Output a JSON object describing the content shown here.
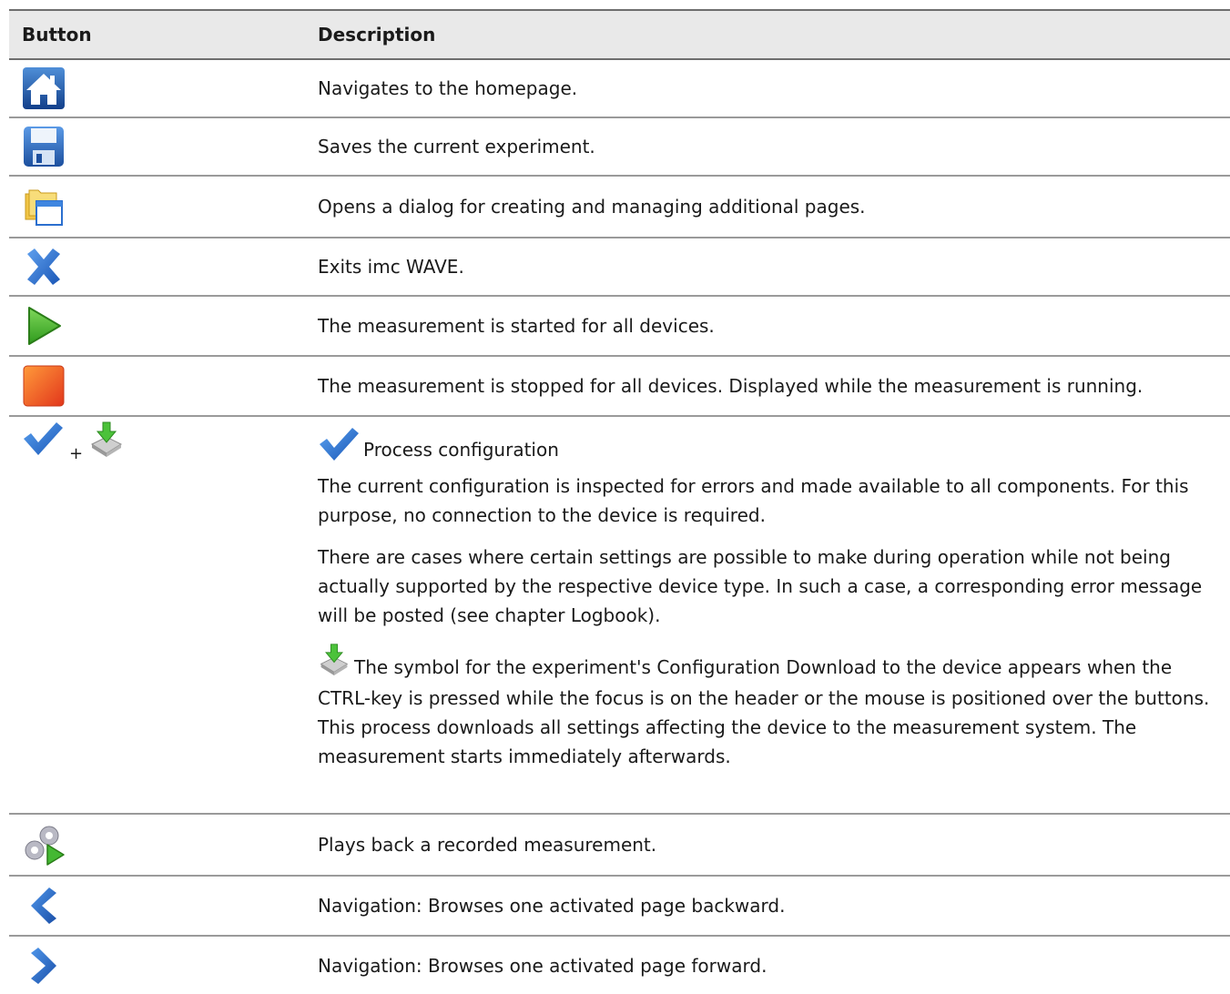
{
  "header": {
    "col_button": "Button",
    "col_description": "Description"
  },
  "rows": [
    {
      "icon": "home-icon",
      "description": "Navigates to the homepage."
    },
    {
      "icon": "save-icon",
      "description": "Saves the current experiment."
    },
    {
      "icon": "pages-icon",
      "description": "Opens a dialog for creating and managing additional pages."
    },
    {
      "icon": "close-icon",
      "description": "Exits imc WAVE."
    },
    {
      "icon": "play-icon",
      "description": "The measurement is started for all devices."
    },
    {
      "icon": "stop-icon",
      "description": "The measurement is stopped for all devices. Displayed while the measurement is running."
    }
  ],
  "process": {
    "icons": [
      "checkmark-icon",
      "download-icon"
    ],
    "plus": "+",
    "title": "Process configuration",
    "para1": "The current configuration is inspected for errors and made available to all components. For this purpose, no connection to the device is required.",
    "para2": "There are cases where certain settings are possible to make during operation while not being actually supported by the respective device type. In such a case, a corresponding error message will be posted (see chapter Logbook).",
    "para3": "The symbol for the experiment's Configuration Download  to the device appears when the CTRL-key is pressed while the focus is on the header or the mouse is positioned over the buttons. This process downloads all settings affecting the device to the measurement system. The measurement starts immediately afterwards."
  },
  "rows2": [
    {
      "icon": "playback-gears-icon",
      "description": "Plays back a recorded measurement."
    },
    {
      "icon": "chevron-left-icon",
      "description": "Navigation: Browses one activated page backward."
    },
    {
      "icon": "chevron-right-icon",
      "description": "Navigation: Browses one activated page forward."
    }
  ]
}
